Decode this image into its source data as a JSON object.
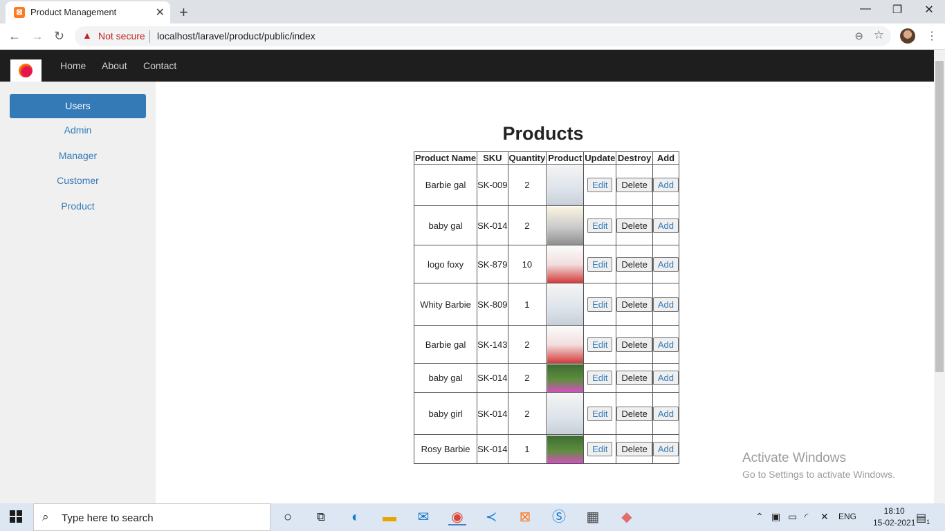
{
  "browser": {
    "tab_title": "Product Management",
    "security_label": "Not secure",
    "url": "localhost/laravel/product/public/index"
  },
  "navbar": {
    "links": [
      "Home",
      "About",
      "Contact"
    ]
  },
  "sidebar": {
    "items": [
      "Users",
      "Admin",
      "Manager",
      "Customer",
      "Product"
    ],
    "active": "Users"
  },
  "page": {
    "heading": "Products"
  },
  "table": {
    "headers": [
      "Product Name",
      "SKU",
      "Quantity",
      "Product",
      "Update",
      "Destroy",
      "Add"
    ],
    "buttons": {
      "edit": "Edit",
      "delete": "Delete",
      "add": "Add"
    },
    "rows": [
      {
        "name": "Barbie gal",
        "sku": "SK-009",
        "quantity": "2",
        "image": "white-gown-doll"
      },
      {
        "name": "baby gal",
        "sku": "SK-014",
        "quantity": "2",
        "image": "gray-outfit-doll"
      },
      {
        "name": "logo foxy",
        "sku": "SK-879",
        "quantity": "10",
        "image": "red-white-gown-doll"
      },
      {
        "name": "Whity Barbie",
        "sku": "SK-809",
        "quantity": "1",
        "image": "white-gown-doll"
      },
      {
        "name": "Barbie gal",
        "sku": "SK-143",
        "quantity": "2",
        "image": "red-white-gown-doll"
      },
      {
        "name": "baby gal",
        "sku": "SK-014",
        "quantity": "2",
        "image": "pink-dress-garden-doll"
      },
      {
        "name": "baby girl",
        "sku": "SK-014",
        "quantity": "2",
        "image": "white-gown-doll"
      },
      {
        "name": "Rosy Barbie",
        "sku": "SK-014",
        "quantity": "1",
        "image": "pink-dress-garden-doll"
      }
    ]
  },
  "watermark": {
    "title": "Activate Windows",
    "subtitle": "Go to Settings to activate Windows."
  },
  "taskbar": {
    "search_placeholder": "Type here to search",
    "language": "ENG",
    "time": "18:10",
    "date": "15-02-2021",
    "notification_count": "1"
  },
  "colors": {
    "navbar_bg": "#1e1e1e",
    "sidebar_bg": "#f0f0f0",
    "accent": "#337ab7"
  }
}
